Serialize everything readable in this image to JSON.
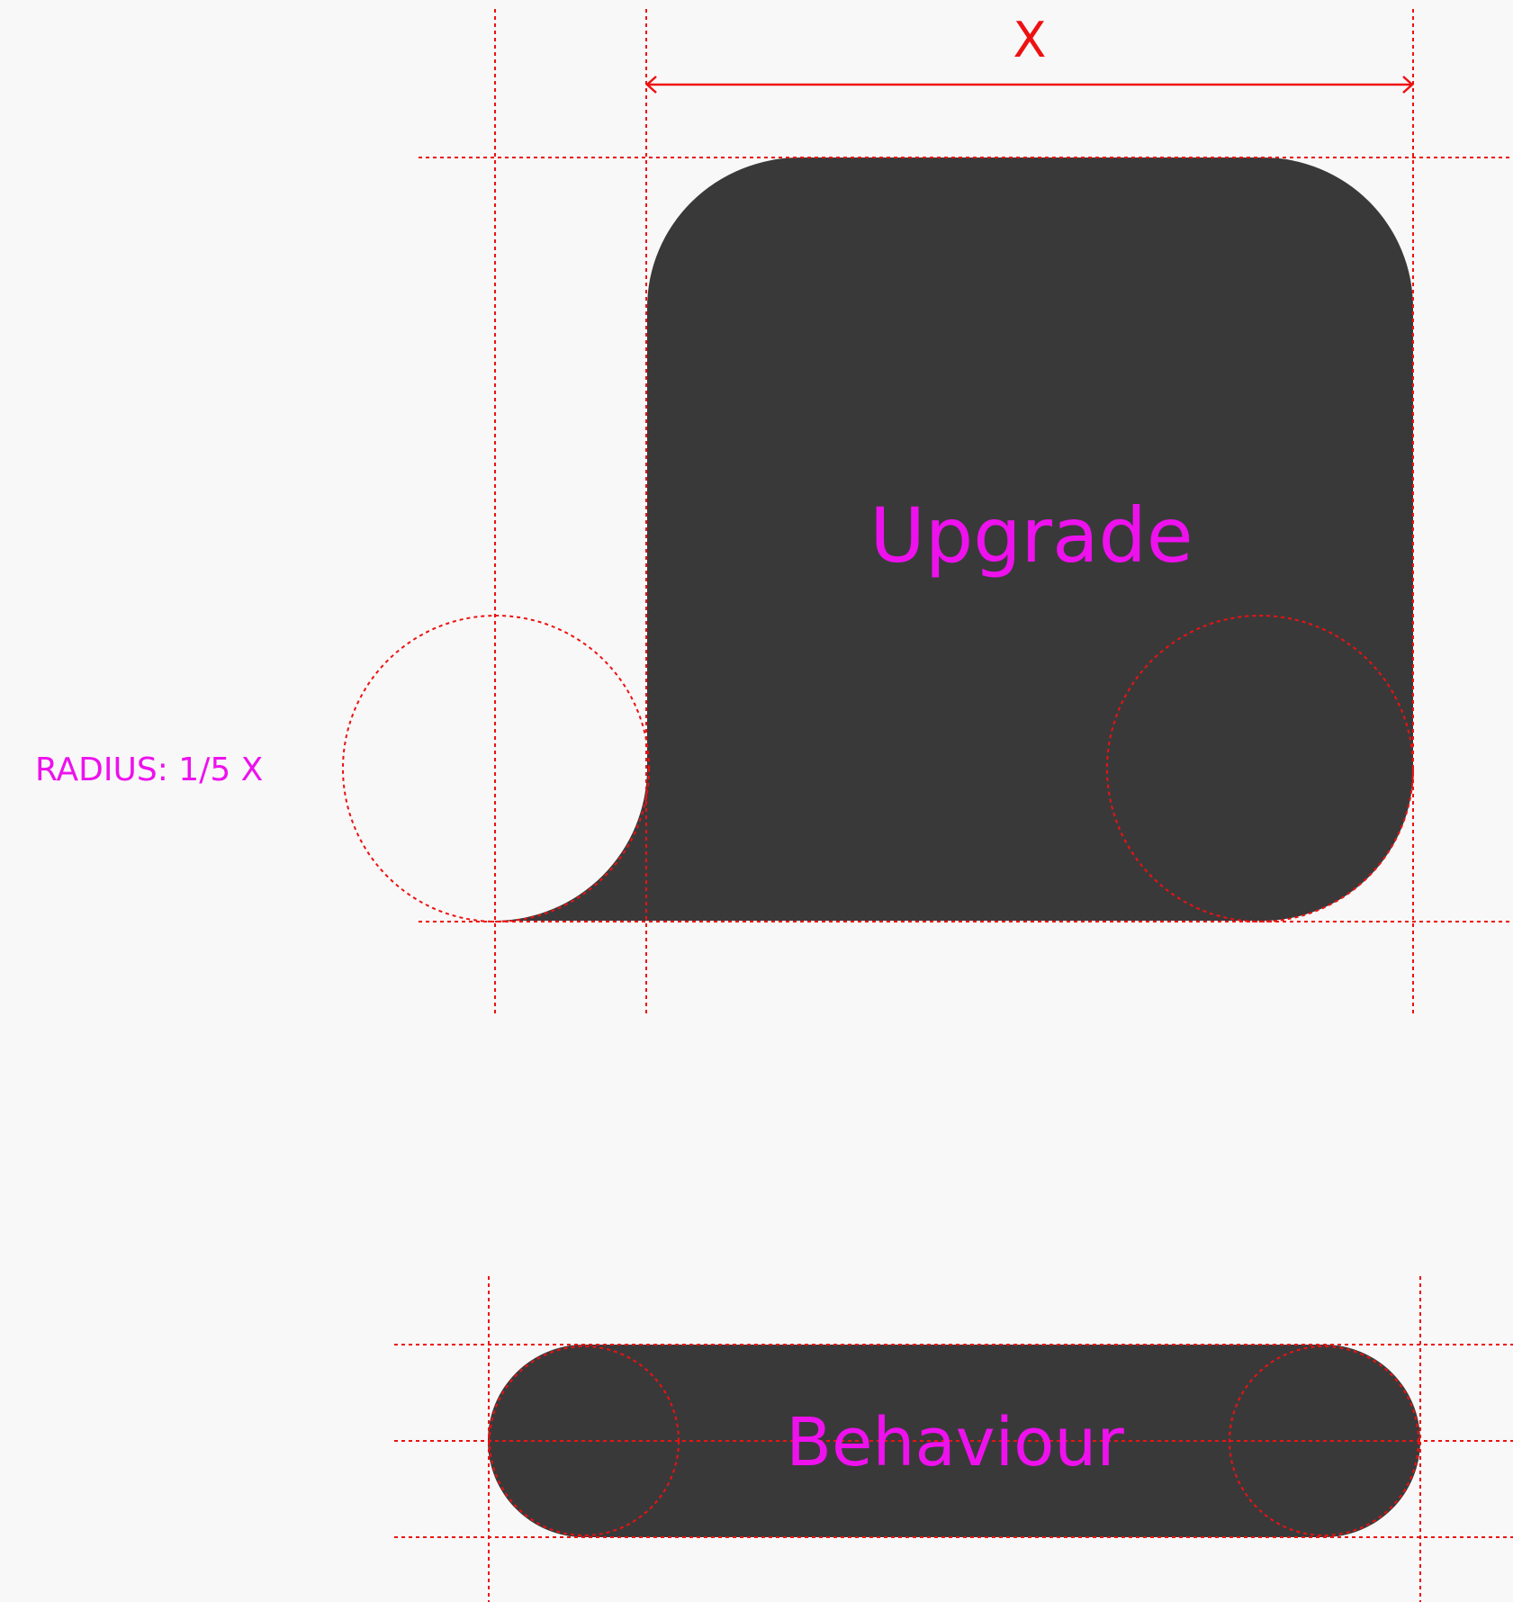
{
  "colors": {
    "background": "#f8f8f8",
    "shape_fill": "#3a393a",
    "guide_line": "#ee1111",
    "label_text": "#ee11ee"
  },
  "dimension": {
    "label": "X"
  },
  "radius_note": "RADIUS: 1/5 X",
  "upgrade_shape": {
    "label": "Upgrade"
  },
  "behaviour_shape": {
    "label": "Behaviour"
  }
}
